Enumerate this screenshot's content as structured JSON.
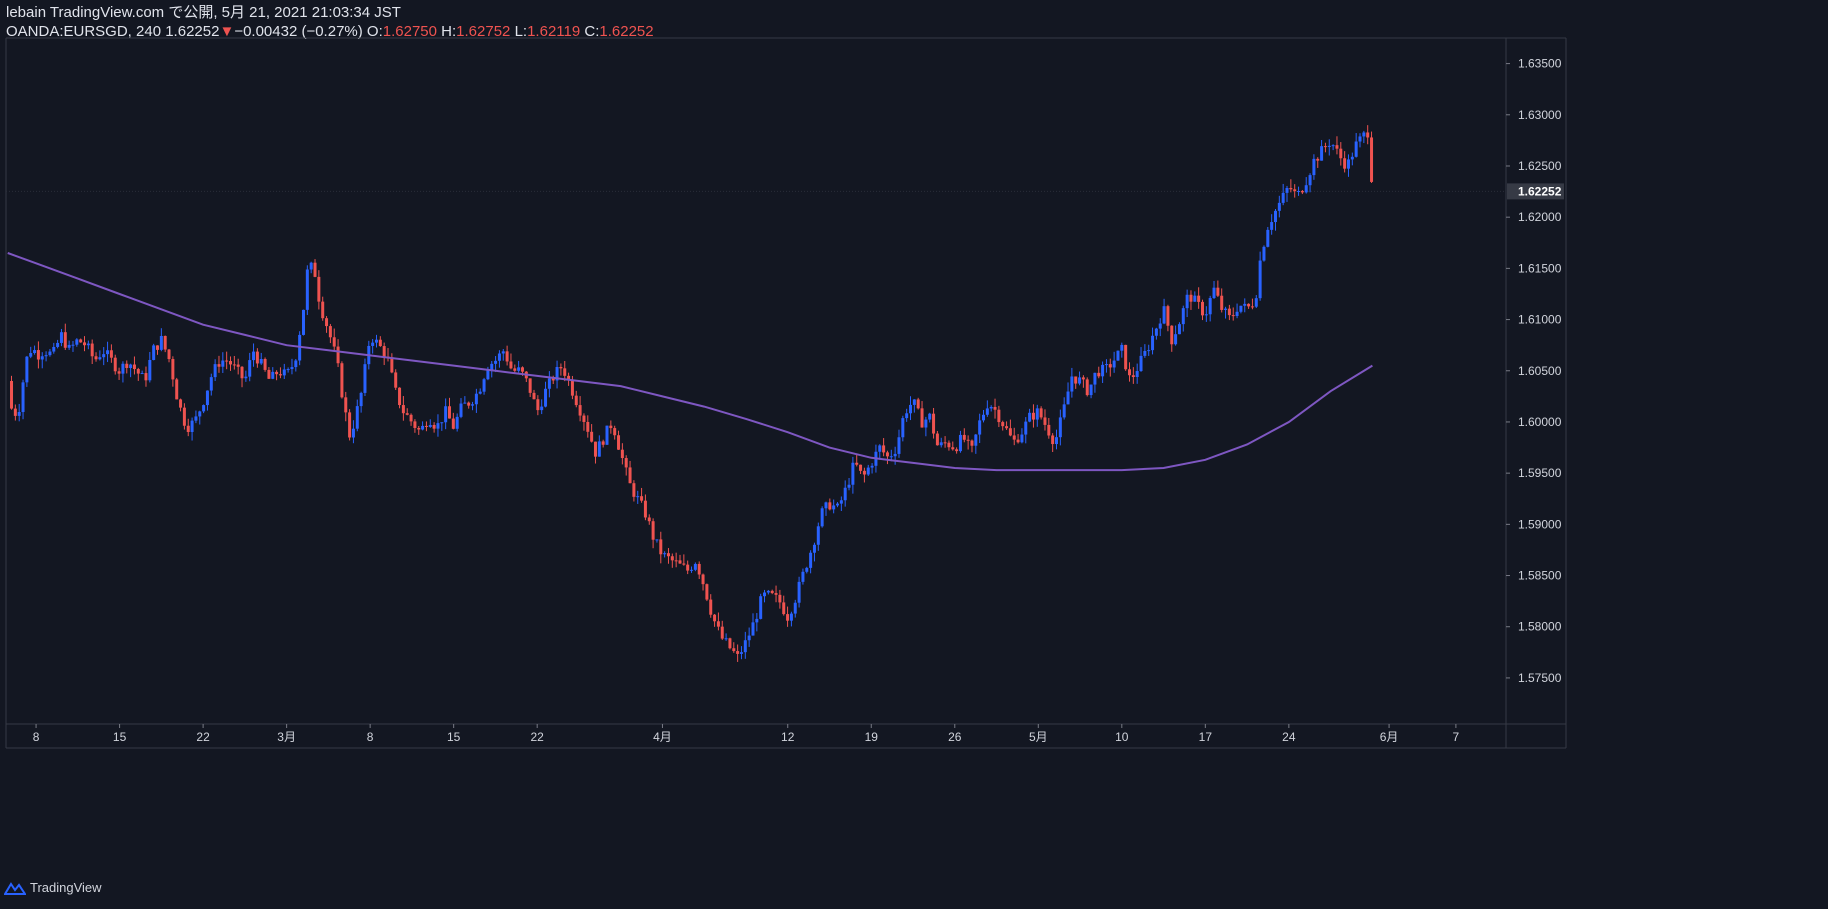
{
  "header": {
    "published": "lebain TradingView.com で公開, 5月 21, 2021 21:03:34 JST",
    "symbol": "OANDA:EURSGD, 240",
    "last": "1.62252",
    "change": "−0.00432 (−0.27%)",
    "o_label": "O:",
    "o_value": "1.62750",
    "h_label": "H:",
    "h_value": "1.62752",
    "l_label": "L:",
    "l_value": "1.62119",
    "c_label": "C:",
    "c_value": "1.62252"
  },
  "footer": {
    "brand": "TradingView"
  },
  "colors": {
    "background": "#131722",
    "up": "#2962ff",
    "down": "#ef5350",
    "ma": "#7e57c2",
    "axis_text": "#d1d4dc",
    "price_tag_bg": "#363a45"
  },
  "chart_data": {
    "type": "candlestick",
    "symbol": "OANDA:EURSGD",
    "timeframe": "240",
    "ylim": [
      1.5705,
      1.6375
    ],
    "y_ticks": [
      "1.63500",
      "1.63000",
      "1.62500",
      "1.62000",
      "1.61500",
      "1.61000",
      "1.60500",
      "1.60000",
      "1.59500",
      "1.59000",
      "1.58500",
      "1.58000",
      "1.57500"
    ],
    "current_price_label": "1.62252",
    "current_price": 1.62252,
    "x_ticks": [
      {
        "label": "8",
        "x": 0
      },
      {
        "label": "15",
        "x": 5
      },
      {
        "label": "22",
        "x": 10
      },
      {
        "label": "3月",
        "x": 15
      },
      {
        "label": "8",
        "x": 20
      },
      {
        "label": "15",
        "x": 25
      },
      {
        "label": "22",
        "x": 30
      },
      {
        "label": "4月",
        "x": 37.5
      },
      {
        "label": "12",
        "x": 45
      },
      {
        "label": "19",
        "x": 50
      },
      {
        "label": "26",
        "x": 55
      },
      {
        "label": "5月",
        "x": 60
      },
      {
        "label": "10",
        "x": 65
      },
      {
        "label": "17",
        "x": 70
      },
      {
        "label": "24",
        "x": 75
      },
      {
        "label": "6月",
        "x": 81
      },
      {
        "label": "7",
        "x": 85
      }
    ],
    "x_range": [
      -1.8,
      88
    ],
    "price_path": [
      [
        -1.7,
        1.604
      ],
      [
        -1.4,
        1.6005
      ],
      [
        -1,
        1.6015
      ],
      [
        -0.6,
        1.606
      ],
      [
        -0.2,
        1.6075
      ],
      [
        0,
        1.6065
      ],
      [
        0.5,
        1.607
      ],
      [
        1,
        1.6065
      ],
      [
        1.5,
        1.6085
      ],
      [
        2,
        1.607
      ],
      [
        2.5,
        1.608
      ],
      [
        3,
        1.6075
      ],
      [
        3.5,
        1.606
      ],
      [
        4,
        1.607
      ],
      [
        4.5,
        1.606
      ],
      [
        5,
        1.605
      ],
      [
        5.5,
        1.606
      ],
      [
        6,
        1.605
      ],
      [
        6.5,
        1.604
      ],
      [
        7,
        1.607
      ],
      [
        7.5,
        1.608
      ],
      [
        8,
        1.606
      ],
      [
        8.5,
        1.602
      ],
      [
        9,
        1.5995
      ],
      [
        9.5,
        1.6
      ],
      [
        10,
        1.602
      ],
      [
        10.5,
        1.6045
      ],
      [
        11,
        1.606
      ],
      [
        11.5,
        1.606
      ],
      [
        12,
        1.605
      ],
      [
        12.5,
        1.604
      ],
      [
        13,
        1.607
      ],
      [
        13.5,
        1.6055
      ],
      [
        14,
        1.604
      ],
      [
        14.5,
        1.605
      ],
      [
        15,
        1.6045
      ],
      [
        15.5,
        1.606
      ],
      [
        16,
        1.611
      ],
      [
        16.3,
        1.6155
      ],
      [
        16.7,
        1.6145
      ],
      [
        17,
        1.6115
      ],
      [
        17.5,
        1.609
      ],
      [
        18,
        1.606
      ],
      [
        18.5,
        1.601
      ],
      [
        18.8,
        1.5985
      ],
      [
        19.2,
        1.601
      ],
      [
        19.5,
        1.603
      ],
      [
        20,
        1.6085
      ],
      [
        20.5,
        1.6075
      ],
      [
        21,
        1.6065
      ],
      [
        21.5,
        1.603
      ],
      [
        22,
        1.601
      ],
      [
        22.5,
        1.6
      ],
      [
        23,
        1.599
      ],
      [
        23.5,
        1.6005
      ],
      [
        24,
        1.5995
      ],
      [
        24.5,
        1.601
      ],
      [
        25,
        1.5995
      ],
      [
        25.5,
        1.6015
      ],
      [
        26,
        1.602
      ],
      [
        26.5,
        1.603
      ],
      [
        27,
        1.6055
      ],
      [
        27.5,
        1.606
      ],
      [
        28,
        1.607
      ],
      [
        28.5,
        1.605
      ],
      [
        29,
        1.605
      ],
      [
        29.5,
        1.6035
      ],
      [
        30,
        1.601
      ],
      [
        30.5,
        1.603
      ],
      [
        31,
        1.6045
      ],
      [
        31.5,
        1.6055
      ],
      [
        32,
        1.6035
      ],
      [
        32.5,
        1.6015
      ],
      [
        33,
        1.5995
      ],
      [
        33.5,
        1.597
      ],
      [
        34,
        1.5985
      ],
      [
        34.5,
        1.6
      ],
      [
        35,
        1.597
      ],
      [
        35.5,
        1.594
      ],
      [
        36,
        1.5925
      ],
      [
        36.5,
        1.591
      ],
      [
        37,
        1.5885
      ],
      [
        37.5,
        1.587
      ],
      [
        38,
        1.5865
      ],
      [
        38.5,
        1.586
      ],
      [
        39,
        1.5855
      ],
      [
        39.5,
        1.5865
      ],
      [
        40,
        1.584
      ],
      [
        40.5,
        1.581
      ],
      [
        41,
        1.579
      ],
      [
        41.5,
        1.578
      ],
      [
        42,
        1.577
      ],
      [
        42.5,
        1.5785
      ],
      [
        43,
        1.5805
      ],
      [
        43.5,
        1.583
      ],
      [
        44,
        1.583
      ],
      [
        44.5,
        1.5825
      ],
      [
        45,
        1.581
      ],
      [
        45.5,
        1.583
      ],
      [
        46,
        1.5855
      ],
      [
        46.5,
        1.588
      ],
      [
        47,
        1.591
      ],
      [
        47.5,
        1.592
      ],
      [
        48,
        1.5915
      ],
      [
        48.5,
        1.5935
      ],
      [
        49,
        1.596
      ],
      [
        49.5,
        1.5945
      ],
      [
        50,
        1.596
      ],
      [
        50.5,
        1.5975
      ],
      [
        51,
        1.5965
      ],
      [
        51.5,
        1.5975
      ],
      [
        52,
        1.601
      ],
      [
        52.5,
        1.602
      ],
      [
        53,
        1.6
      ],
      [
        53.5,
        1.6005
      ],
      [
        54,
        1.5975
      ],
      [
        54.5,
        1.598
      ],
      [
        55,
        1.5975
      ],
      [
        55.5,
        1.5985
      ],
      [
        56,
        1.597
      ],
      [
        56.5,
        1.6
      ],
      [
        57,
        1.602
      ],
      [
        57.5,
        1.601
      ],
      [
        58,
        1.5995
      ],
      [
        58.5,
        1.598
      ],
      [
        59,
        1.599
      ],
      [
        59.5,
        1.6005
      ],
      [
        60,
        1.601
      ],
      [
        60.5,
        1.5995
      ],
      [
        61,
        1.598
      ],
      [
        61.5,
        1.601
      ],
      [
        62,
        1.6045
      ],
      [
        62.5,
        1.604
      ],
      [
        63,
        1.603
      ],
      [
        63.5,
        1.605
      ],
      [
        64,
        1.605
      ],
      [
        64.5,
        1.606
      ],
      [
        65,
        1.607
      ],
      [
        65.5,
        1.604
      ],
      [
        66,
        1.6055
      ],
      [
        66.5,
        1.607
      ],
      [
        67,
        1.609
      ],
      [
        67.5,
        1.611
      ],
      [
        68,
        1.608
      ],
      [
        68.5,
        1.61
      ],
      [
        69,
        1.6125
      ],
      [
        69.5,
        1.6115
      ],
      [
        70,
        1.6105
      ],
      [
        70.5,
        1.613
      ],
      [
        71,
        1.611
      ],
      [
        71.5,
        1.61
      ],
      [
        72,
        1.6115
      ],
      [
        72.5,
        1.611
      ],
      [
        73,
        1.612
      ],
      [
        73.3,
        1.616
      ],
      [
        73.7,
        1.619
      ],
      [
        74,
        1.62
      ],
      [
        74.5,
        1.6215
      ],
      [
        75,
        1.623
      ],
      [
        75.5,
        1.622
      ],
      [
        76,
        1.6235
      ],
      [
        76.5,
        1.6255
      ],
      [
        77,
        1.6265
      ],
      [
        77.5,
        1.6275
      ],
      [
        78,
        1.626
      ],
      [
        78.5,
        1.625
      ],
      [
        79,
        1.627
      ],
      [
        79.5,
        1.628
      ],
      [
        79.8,
        1.6285
      ],
      [
        80.0,
        1.6225
      ]
    ],
    "series": [
      {
        "name": "MA",
        "points": [
          [
            -1.7,
            1.6165
          ],
          [
            0,
            1.6155
          ],
          [
            2.5,
            1.614
          ],
          [
            5,
            1.6125
          ],
          [
            7.5,
            1.611
          ],
          [
            10,
            1.6095
          ],
          [
            12.5,
            1.6085
          ],
          [
            15,
            1.6075
          ],
          [
            17.5,
            1.607
          ],
          [
            20,
            1.6065
          ],
          [
            22.5,
            1.606
          ],
          [
            25,
            1.6055
          ],
          [
            27.5,
            1.605
          ],
          [
            30,
            1.6045
          ],
          [
            32.5,
            1.604
          ],
          [
            35,
            1.6035
          ],
          [
            37.5,
            1.6025
          ],
          [
            40,
            1.6015
          ],
          [
            42.5,
            1.6003
          ],
          [
            45,
            1.599
          ],
          [
            47.5,
            1.5975
          ],
          [
            50,
            1.5965
          ],
          [
            52.5,
            1.596
          ],
          [
            55,
            1.5955
          ],
          [
            57.5,
            1.5953
          ],
          [
            60,
            1.5953
          ],
          [
            62.5,
            1.5953
          ],
          [
            65,
            1.5953
          ],
          [
            67.5,
            1.5955
          ],
          [
            70,
            1.5963
          ],
          [
            72.5,
            1.5978
          ],
          [
            75,
            1.6
          ],
          [
            77.5,
            1.603
          ],
          [
            80,
            1.6055
          ]
        ]
      }
    ]
  }
}
